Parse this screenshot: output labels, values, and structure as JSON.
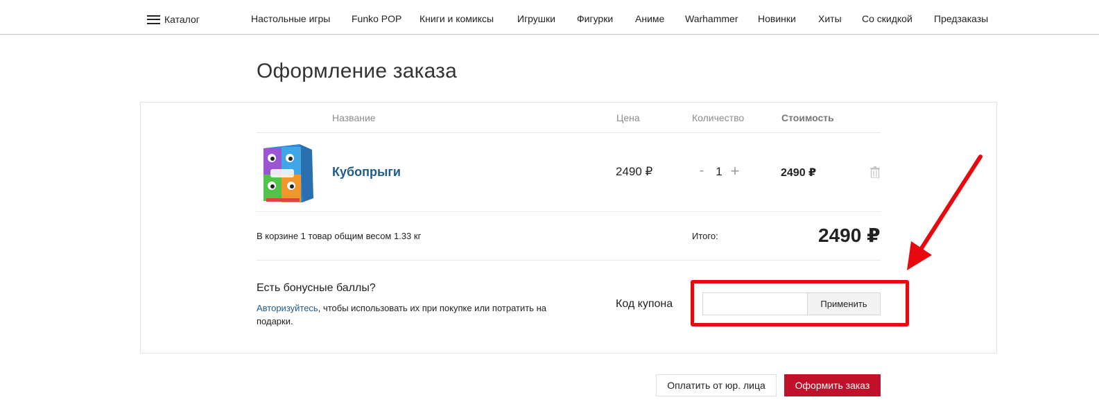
{
  "nav": {
    "catalog_label": "Каталог",
    "items": [
      "Настольные игры",
      "Funko POP",
      "Книги и комиксы",
      "Игрушки",
      "Фигурки",
      "Аниме",
      "Warhammer",
      "Новинки",
      "Хиты",
      "Со скидкой",
      "Предзаказы"
    ]
  },
  "page": {
    "title": "Оформление заказа"
  },
  "cart": {
    "headers": {
      "name": "Название",
      "price": "Цена",
      "quantity": "Количество",
      "cost": "Стоимость"
    },
    "item": {
      "name": "Кубопрыги",
      "price": "2490 ₽",
      "qty_minus": "-",
      "quantity": "1",
      "qty_plus": "+",
      "cost": "2490 ₽"
    },
    "summary": "В корзине 1 товар общим весом 1.33 кг",
    "total_label": "Итого:",
    "total_value": "2490 ₽"
  },
  "bonus": {
    "title": "Есть бонусные баллы?",
    "link": "Авторизуйтесь",
    "text": ", чтобы использовать их при покупке или потратить на подарки."
  },
  "coupon": {
    "label": "Код купона",
    "value": "",
    "apply_label": "Применить"
  },
  "actions": {
    "legal_label": "Оплатить от юр. лица",
    "order_label": "Оформить заказ"
  },
  "colors": {
    "accent": "#c0102a",
    "link": "#1f5b8a",
    "highlight": "#e8090f"
  },
  "icons": {
    "menu": "hamburger-icon",
    "delete": "trash-icon",
    "annotation": "arrow-icon"
  }
}
